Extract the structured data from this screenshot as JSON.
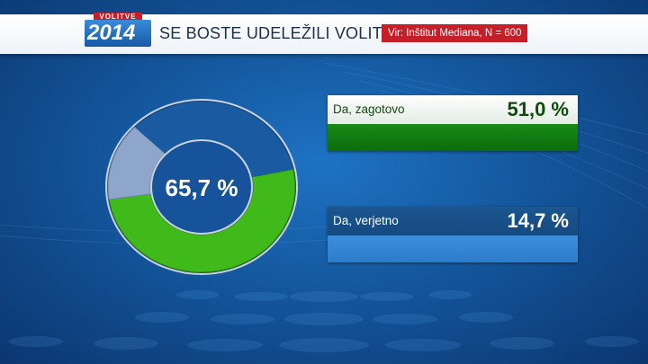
{
  "header": {
    "logo_small": "VOLITVE",
    "logo_year": "2014",
    "question": "SE BOSTE UDELEŽILI VOLITEV?",
    "source": "Vir: Inštitut Mediana, N = 600"
  },
  "chart_data": {
    "type": "pie",
    "center_label": "65,7 %",
    "categories": [
      "Da, zagotovo",
      "Da, verjetno"
    ],
    "values": [
      51.0,
      14.7
    ],
    "value_labels": [
      "51,0 %",
      "14,7 %"
    ],
    "colors": [
      "#3fba1a",
      "#8ea6c9"
    ],
    "remainder_color": "#1a5aa0"
  }
}
